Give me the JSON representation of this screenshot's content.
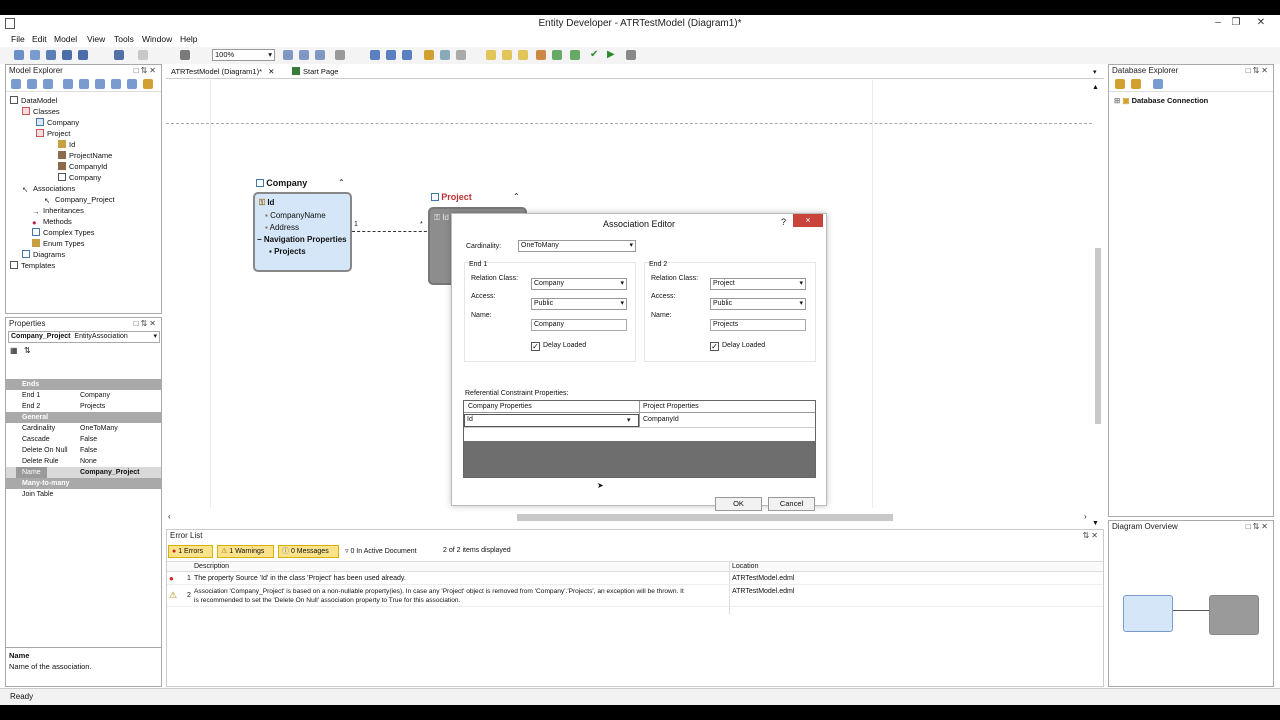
{
  "window": {
    "title": "Entity Developer - ATRTestModel (Diagram1)*"
  },
  "menu": {
    "items": [
      "File",
      "Edit",
      "Model",
      "View",
      "Tools",
      "Window",
      "Help"
    ]
  },
  "toolbar": {
    "zoom": "100%"
  },
  "model_explorer": {
    "title": "Model Explorer",
    "nodes": {
      "datamodel": "DataModel",
      "classes": "Classes",
      "company": "Company",
      "project": "Project",
      "id": "Id",
      "projectname": "ProjectName",
      "companyid": "CompanyId",
      "company_nav": "Company",
      "associations": "Associations",
      "company_project": "Company_Project",
      "inheritances": "Inheritances",
      "methods": "Methods",
      "complex_types": "Complex Types",
      "enum_types": "Enum Types",
      "diagrams": "Diagrams",
      "templates": "Templates"
    }
  },
  "properties": {
    "title": "Properties",
    "object_name": "Company_Project",
    "object_type": "EntityAssociation",
    "cat_ends": "Ends",
    "end1_label": "End 1",
    "end1_value": "Company",
    "end2_label": "End 2",
    "end2_value": "Projects",
    "cat_general": "General",
    "cardinality_label": "Cardinality",
    "cardinality_value": "OneToMany",
    "cascade_label": "Cascade",
    "cascade_value": "False",
    "delete_on_null_label": "Delete On Null",
    "delete_on_null_value": "False",
    "delete_rule_label": "Delete Rule",
    "delete_rule_value": "None",
    "name_label": "Name",
    "name_value": "Company_Project",
    "cat_many": "Many-to-many",
    "join_table_label": "Join Table",
    "desc_title": "Name",
    "desc_text": "Name of the association."
  },
  "tabs": {
    "diagram": "ATRTestModel (Diagram1)*",
    "start": "Start Page"
  },
  "diagram": {
    "company": {
      "title": "Company",
      "id": "Id",
      "name": "CompanyName",
      "address": "Address",
      "nav_header": "Navigation Properties",
      "nav": "Projects"
    },
    "project": {
      "title": "Project",
      "id": "Id"
    },
    "mult_left": "1",
    "mult_right": "*"
  },
  "dialog": {
    "title": "Association Editor",
    "help": "?",
    "close": "×",
    "cardinality_label": "Cardinality:",
    "cardinality_value": "OneToMany",
    "end1": {
      "title": "End 1",
      "relation_label": "Relation Class:",
      "relation_value": "Company",
      "access_label": "Access:",
      "access_value": "Public",
      "name_label": "Name:",
      "name_value": "Company",
      "delay_label": "Delay Loaded"
    },
    "end2": {
      "title": "End 2",
      "relation_label": "Relation Class:",
      "relation_value": "Project",
      "access_label": "Access:",
      "access_value": "Public",
      "name_label": "Name:",
      "name_value": "Projects",
      "delay_label": "Delay Loaded"
    },
    "ref_title": "Referential Constraint Properties:",
    "col_company": "Company Properties",
    "col_project": "Project Properties",
    "row_company": "Id",
    "row_project": "CompanyId",
    "ok": "OK",
    "cancel": "Cancel"
  },
  "error_list": {
    "title": "Error List",
    "errors": "1 Errors",
    "warnings": "1 Warnings",
    "messages": "0 Messages",
    "filter": "0 In Active Document",
    "displayed": "2 of 2 items displayed",
    "col_desc": "Description",
    "col_loc": "Location",
    "rows": [
      {
        "num": "1",
        "desc": "The property Source 'Id' in the class 'Project' has been used already.",
        "loc": "ATRTestModel.edml"
      },
      {
        "num": "2",
        "desc1": "Association 'Company_Project' is based on a non-nullable property(ies). In case any 'Project' object is removed from 'Company'.'Projects', an exception will be thrown. It",
        "desc2": "is recommended to set the 'Delete On Null' association property to True for this association.",
        "loc": "ATRTestModel.edml"
      }
    ]
  },
  "database_explorer": {
    "title": "Database Explorer",
    "node": "Database Connection"
  },
  "diagram_overview": {
    "title": "Diagram Overview"
  },
  "status": {
    "text": "Ready"
  }
}
